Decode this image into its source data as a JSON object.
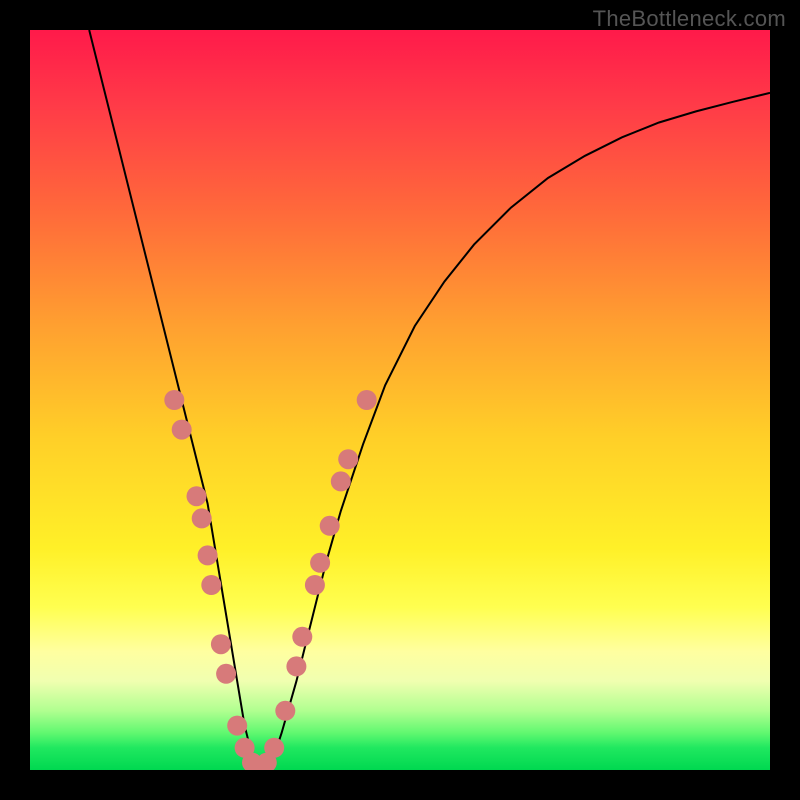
{
  "watermark": "TheBottleneck.com",
  "chart_data": {
    "type": "line",
    "title": "",
    "xlabel": "",
    "ylabel": "",
    "xlim": [
      0,
      100
    ],
    "ylim": [
      0,
      100
    ],
    "series": [
      {
        "name": "curve",
        "x": [
          8,
          10,
          12,
          14,
          16,
          18,
          20,
          22,
          24,
          25,
          26,
          27,
          28,
          29,
          30,
          31,
          32,
          33,
          34,
          36,
          38,
          40,
          42,
          45,
          48,
          52,
          56,
          60,
          65,
          70,
          75,
          80,
          85,
          90,
          95,
          100
        ],
        "values": [
          100,
          92,
          84,
          76,
          68,
          60,
          52,
          44,
          36,
          30,
          24,
          18,
          12,
          6,
          2,
          0,
          0,
          2,
          5,
          12,
          20,
          28,
          35,
          44,
          52,
          60,
          66,
          71,
          76,
          80,
          83,
          85.5,
          87.5,
          89,
          90.3,
          91.5
        ]
      }
    ],
    "beads": [
      {
        "x": 19.5,
        "y": 50
      },
      {
        "x": 20.5,
        "y": 46
      },
      {
        "x": 22.5,
        "y": 37
      },
      {
        "x": 23.2,
        "y": 34
      },
      {
        "x": 24.0,
        "y": 29
      },
      {
        "x": 24.5,
        "y": 25
      },
      {
        "x": 25.8,
        "y": 17
      },
      {
        "x": 26.5,
        "y": 13
      },
      {
        "x": 28.0,
        "y": 6
      },
      {
        "x": 29.0,
        "y": 3
      },
      {
        "x": 30.0,
        "y": 1
      },
      {
        "x": 31.0,
        "y": 0
      },
      {
        "x": 32.0,
        "y": 1
      },
      {
        "x": 33.0,
        "y": 3
      },
      {
        "x": 34.5,
        "y": 8
      },
      {
        "x": 36.0,
        "y": 14
      },
      {
        "x": 36.8,
        "y": 18
      },
      {
        "x": 38.5,
        "y": 25
      },
      {
        "x": 39.2,
        "y": 28
      },
      {
        "x": 40.5,
        "y": 33
      },
      {
        "x": 42.0,
        "y": 39
      },
      {
        "x": 43.0,
        "y": 42
      },
      {
        "x": 45.5,
        "y": 50
      }
    ],
    "bead_color": "#d77a7a",
    "curve_color": "#000000"
  }
}
